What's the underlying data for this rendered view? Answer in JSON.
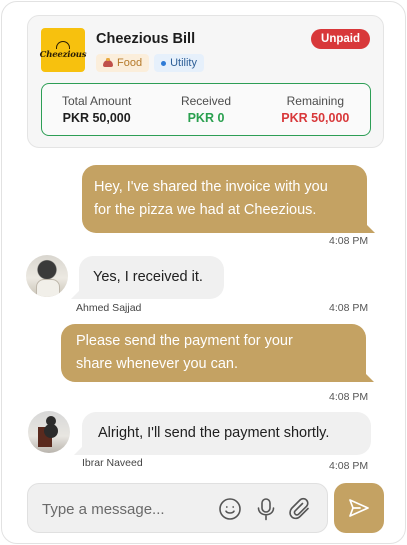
{
  "bill": {
    "logo_text": "Cheezious",
    "title": "Cheezious Bill",
    "status": "Unpaid",
    "tags": [
      {
        "label": "Food",
        "icon": "food-icon"
      },
      {
        "label": "Utility",
        "icon": "dot-icon"
      }
    ],
    "amounts": [
      {
        "label": "Total Amount",
        "value": "PKR 50,000"
      },
      {
        "label": "Received",
        "value": "PKR 0"
      },
      {
        "label": "Remaining",
        "value": "PKR 50,000"
      }
    ]
  },
  "messages": [
    {
      "direction": "out",
      "text_lines": [
        "Hey, I've shared the invoice with you",
        "for the pizza we had at Cheezious."
      ],
      "time": "4:08 PM"
    },
    {
      "direction": "in",
      "sender": "Ahmed Sajjad",
      "text": "Yes, I received it.",
      "time": "4:08 PM"
    },
    {
      "direction": "out",
      "text_lines": [
        "Please send the payment for your",
        "share whenever you can."
      ],
      "time": "4:08 PM"
    },
    {
      "direction": "in",
      "sender": "Ibrar Naveed",
      "text": "Alright, I'll send the payment shortly.",
      "time": "4:08 PM"
    }
  ],
  "composer": {
    "placeholder": "Type a message...",
    "icons": [
      "emoji-icon",
      "microphone-icon",
      "paperclip-icon"
    ],
    "send_icon": "send-icon"
  },
  "colors": {
    "accent": "#c4a263",
    "unpaid": "#d8383a",
    "received": "#2aa04f",
    "border_green": "#2d9e55"
  }
}
